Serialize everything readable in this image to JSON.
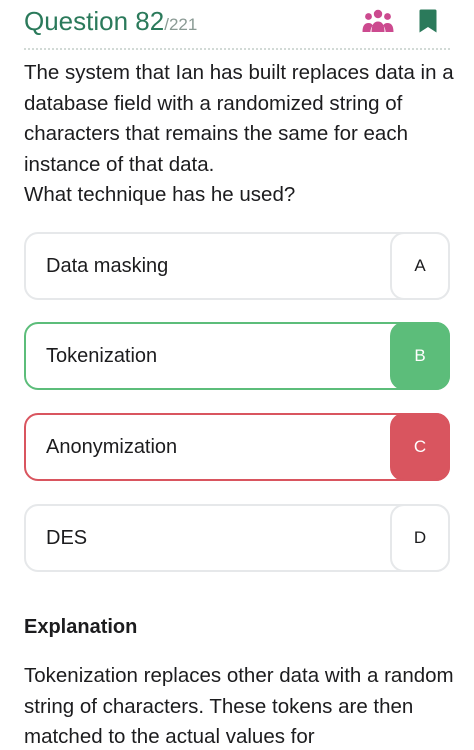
{
  "header": {
    "question_label": "Question 82",
    "question_total": "/221",
    "people_icon": "people-group-icon",
    "bookmark_icon": "bookmark-icon",
    "accent_color": "#2b7a5b"
  },
  "question": {
    "text": "The system that Ian has built replaces data in a database field with a randomized string of characters that remains the same for each instance of that data.",
    "prompt": "What technique has he used?"
  },
  "options": [
    {
      "label": "Data masking",
      "letter": "A",
      "state": "neutral"
    },
    {
      "label": "Tokenization",
      "letter": "B",
      "state": "correct"
    },
    {
      "label": "Anonymization",
      "letter": "C",
      "state": "wrong"
    },
    {
      "label": "DES",
      "letter": "D",
      "state": "neutral"
    }
  ],
  "explanation": {
    "title": "Explanation",
    "text": "Tokenization replaces other data with a random string of characters. These tokens are then matched to the actual values for"
  },
  "colors": {
    "correct": "#5cbd7a",
    "wrong": "#d9555f",
    "icon_purple": "#cc4a8f"
  }
}
